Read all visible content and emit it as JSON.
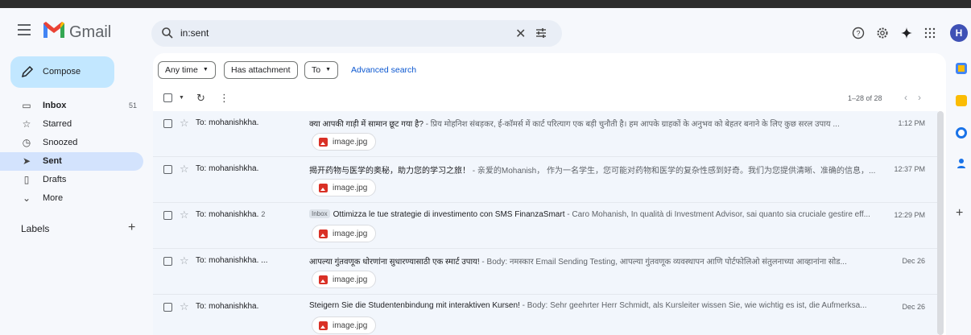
{
  "app": {
    "brand": "Gmail",
    "avatar_initial": "H"
  },
  "search": {
    "value": "in:sent"
  },
  "compose_label": "Compose",
  "nav": [
    {
      "icon": "inbox-icon",
      "label": "Inbox",
      "count": "51",
      "bold": true,
      "active": false
    },
    {
      "icon": "star-icon",
      "label": "Starred",
      "count": "",
      "bold": false,
      "active": false
    },
    {
      "icon": "clock-icon",
      "label": "Snoozed",
      "count": "",
      "bold": false,
      "active": false
    },
    {
      "icon": "send-icon",
      "label": "Sent",
      "count": "",
      "bold": true,
      "active": true
    },
    {
      "icon": "draft-icon",
      "label": "Drafts",
      "count": "",
      "bold": false,
      "active": false
    },
    {
      "icon": "chevron-down-icon",
      "label": "More",
      "count": "",
      "bold": false,
      "active": false
    }
  ],
  "labels": {
    "title": "Labels"
  },
  "filters": {
    "any_time": "Any time",
    "has_attachment": "Has attachment",
    "to": "To",
    "advanced": "Advanced search"
  },
  "pager": {
    "range": "1–28 of 28"
  },
  "emails": [
    {
      "from": "To: mohanishkha.",
      "thread": "",
      "inbox": false,
      "subject": "क्या आपकी गाड़ी में सामान छूट गया है?",
      "snippet": " - प्रिय मोहनिश संबड़कर, ई-कॉमर्स में कार्ट परित्याग एक बड़ी चुनौती है। हम आपके ग्राहकों के अनुभव को बेहतर बनाने के लिए कुछ सरल उपाय ...",
      "time": "1:12 PM",
      "attachment": "image.jpg"
    },
    {
      "from": "To: mohanishkha.",
      "thread": "",
      "inbox": false,
      "subject": "揭开药物与医学的奥秘，助力您的学习之旅！",
      "snippet": " - 亲爱的Mohanish，  作为一名学生，您可能对药物和医学的复杂性感到好奇。我们为您提供清晰、准确的信息，...",
      "time": "12:37 PM",
      "attachment": "image.jpg"
    },
    {
      "from": "To: mohanishkha.",
      "thread": "2",
      "inbox": true,
      "inbox_label": "Inbox",
      "subject": "Ottimizza le tue strategie di investimento con SMS FinanzaSmart",
      "snippet": " - Caro Mohanish, In qualità di Investment Advisor, sai quanto sia cruciale gestire eff...",
      "time": "12:29 PM",
      "attachment": "image.jpg"
    },
    {
      "from": "To: mohanishkha. ...",
      "thread": "",
      "inbox": false,
      "subject": "आपल्या गुंतवणूक धोरणांना सुधारण्यासाठी एक स्मार्ट उपाय!",
      "snippet": " - Body: नमस्कार Email Sending Testing, आपल्या गुंतवणूक व्यवस्थापन आणि पोर्टफोलिओ संतुलनाच्या आव्हानांना सोड...",
      "time": "Dec 26",
      "attachment": "image.jpg"
    },
    {
      "from": "To: mohanishkha.",
      "thread": "",
      "inbox": false,
      "subject": "Steigern Sie die Studentenbindung mit interaktiven Kursen!",
      "snippet": " - Body: Sehr geehrter Herr Schmidt, als Kursleiter wissen Sie, wie wichtig es ist, die Aufmerksa...",
      "time": "Dec 26",
      "attachment": "image.jpg"
    }
  ],
  "colors": {
    "accent": "#0b57d0",
    "compose": "#c2e7ff",
    "active_nav": "#d3e3fd",
    "avatar": "#3f51b5"
  }
}
